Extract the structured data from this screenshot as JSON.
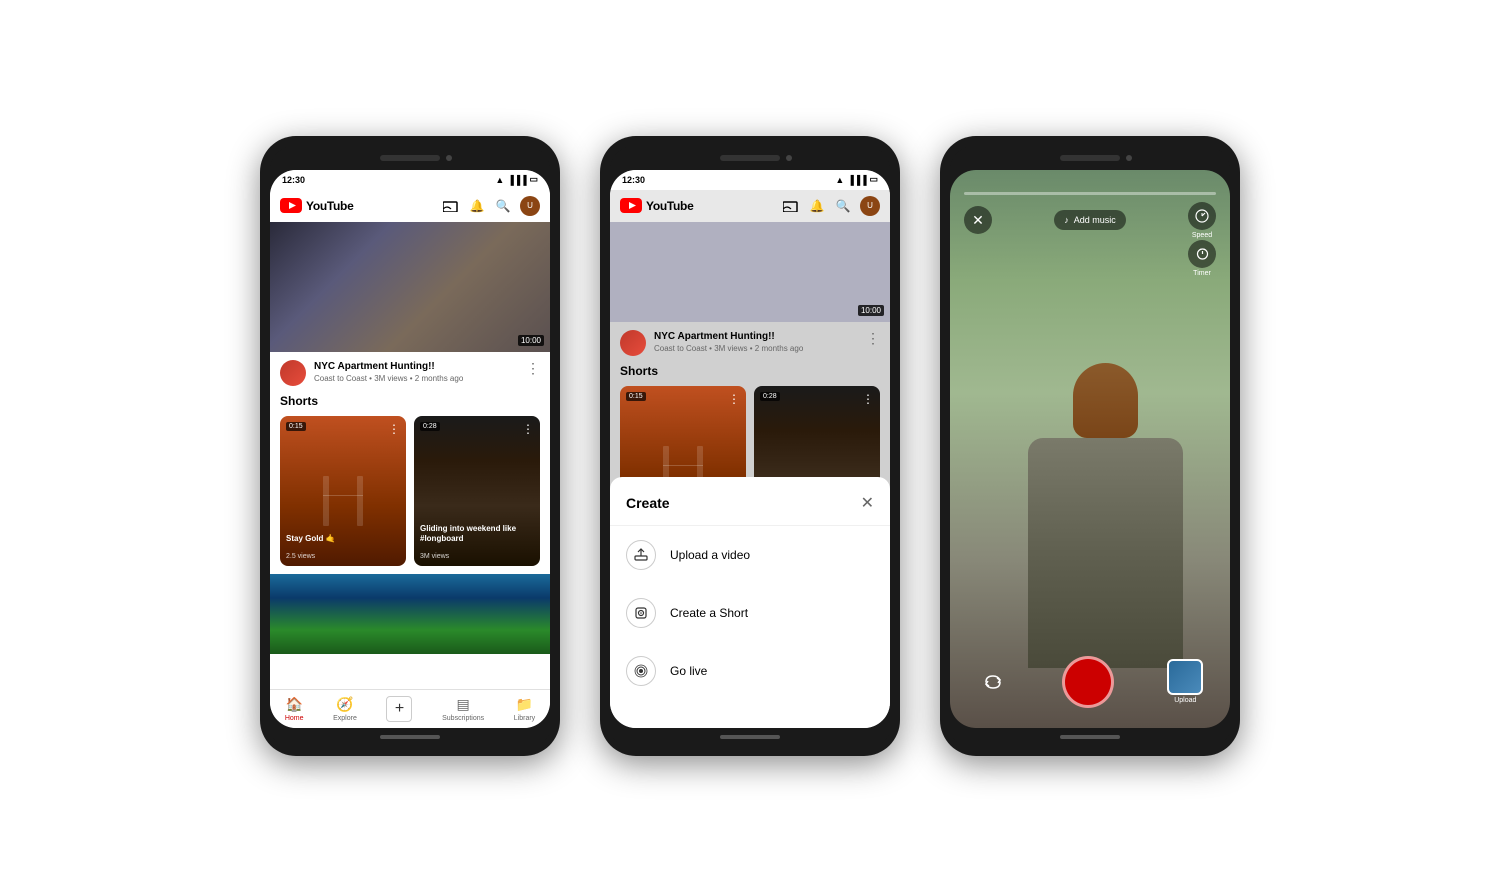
{
  "phones": [
    {
      "id": "phone1",
      "statusBar": {
        "time": "12:30",
        "icons": [
          "wifi",
          "signal",
          "battery"
        ]
      },
      "header": {
        "logoText": "YouTube",
        "icons": [
          "cast",
          "bell",
          "search",
          "avatar"
        ]
      },
      "videoThumb": {
        "duration": "10:00"
      },
      "videoInfo": {
        "title": "NYC Apartment Hunting!!",
        "channel": "Coast to Coast",
        "views": "3M views",
        "timeAgo": "2 months ago"
      },
      "shorts": {
        "sectionTitle": "Shorts",
        "items": [
          {
            "duration": "0:15",
            "title": "Stay Gold 🤙",
            "views": "2.5 views"
          },
          {
            "duration": "0:28",
            "title": "Gliding into weekend like #longboard",
            "views": "3M views"
          }
        ]
      },
      "bottomNav": [
        {
          "label": "Home",
          "active": true,
          "icon": "🏠"
        },
        {
          "label": "Explore",
          "active": false,
          "icon": "🧭"
        },
        {
          "label": "",
          "active": false,
          "icon": "+"
        },
        {
          "label": "Subscriptions",
          "active": false,
          "icon": "▤"
        },
        {
          "label": "Library",
          "active": false,
          "icon": "📁"
        }
      ]
    },
    {
      "id": "phone2",
      "createMenu": {
        "title": "Create",
        "closeIcon": "✕",
        "items": [
          {
            "icon": "⬆",
            "label": "Upload a video"
          },
          {
            "icon": "📷",
            "label": "Create a Short"
          },
          {
            "icon": "📡",
            "label": "Go live"
          }
        ]
      }
    },
    {
      "id": "phone3",
      "camera": {
        "progressBar": true,
        "addMusicLabel": "Add music",
        "speedLabel": "Speed",
        "timerLabel": "Timer",
        "uploadLabel": "Upload",
        "closeIcon": "✕",
        "flipIcon": "↺",
        "musicIcon": "♪",
        "speedIcon": "⏱",
        "timerIcon": "⏰"
      }
    }
  ]
}
